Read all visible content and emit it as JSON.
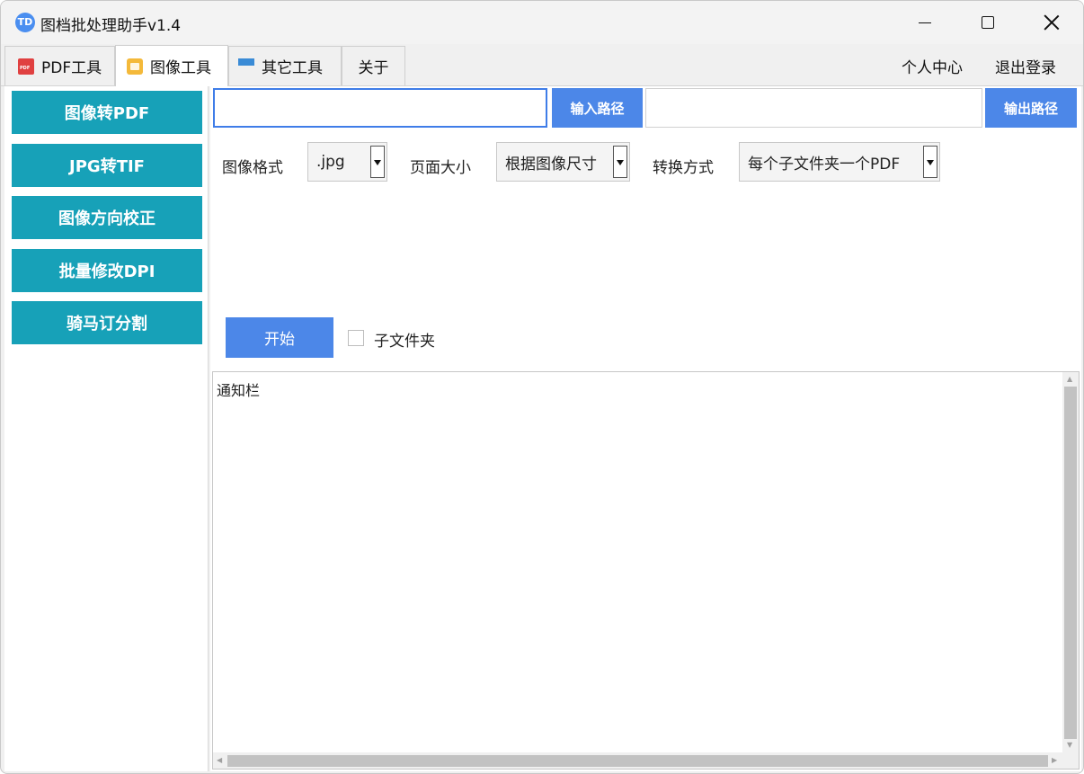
{
  "window": {
    "title": "图档批处理助手v1.4",
    "logo_text": "TD"
  },
  "tabs": [
    {
      "label": "PDF工具",
      "icon": "pdf-icon"
    },
    {
      "label": "图像工具",
      "icon": "image-icon"
    },
    {
      "label": "其它工具",
      "icon": "grid-icon"
    },
    {
      "label": "关于"
    }
  ],
  "header_links": {
    "profile": "个人中心",
    "logout": "退出登录"
  },
  "sidebar": {
    "items": [
      "图像转PDF",
      "JPG转TIF",
      "图像方向校正",
      "批量修改DPI",
      "骑马订分割"
    ]
  },
  "paths": {
    "input_value": "",
    "input_button": "输入路径",
    "output_value": "",
    "output_button": "输出路径"
  },
  "options": {
    "format_label": "图像格式",
    "format_value": ".jpg",
    "pagesize_label": "页面大小",
    "pagesize_value": "根据图像尺寸",
    "mode_label": "转换方式",
    "mode_value": "每个子文件夹一个PDF"
  },
  "actions": {
    "start": "开始",
    "subfolder_label": "子文件夹",
    "subfolder_checked": false
  },
  "notify": {
    "text": "通知栏"
  },
  "colors": {
    "sidebar_button": "#17a1b8",
    "primary_button": "#4c87e8"
  }
}
